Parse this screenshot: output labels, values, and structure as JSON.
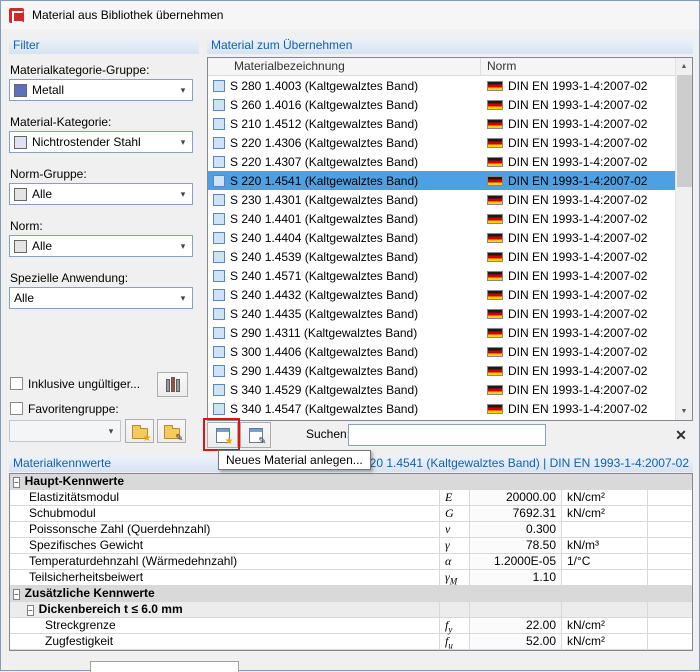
{
  "window": {
    "title": "Material aus Bibliothek übernehmen"
  },
  "colors": {
    "selection_bg": "#4da0e4",
    "band_text": "#1560a8",
    "annotation_red": "#e01212",
    "flag_black": "#1a1a1a",
    "flag_red": "#d00000",
    "flag_gold": "#ffce00"
  },
  "icons": {
    "combo_arrow": "▾",
    "scroll_up": "▲",
    "scroll_down": "▼",
    "clear": "✕",
    "new_star": "★",
    "pencil": "✎",
    "collapse": "−"
  },
  "filter": {
    "header": "Filter",
    "category_group": {
      "label": "Materialkategorie-Gruppe:",
      "value": "Metall",
      "icon_fill": "#5f6fc0"
    },
    "category": {
      "label": "Material-Kategorie:",
      "value": "Nichtrostender Stahl",
      "icon_fill": "#dfe2f2"
    },
    "norm_group": {
      "label": "Norm-Gruppe:",
      "value": "Alle",
      "icon_fill": "#e4e4e4"
    },
    "norm": {
      "label": "Norm:",
      "value": "Alle",
      "icon_fill": "#e4e4e4"
    },
    "special": {
      "label": "Spezielle Anwendung:",
      "value": "Alle"
    },
    "include_invalid_label": "Inklusive ungültiger...",
    "favorites_label": "Favoritengruppe:",
    "favorites_combo_value": ""
  },
  "materials": {
    "header": "Material zum Übernehmen",
    "columns": [
      "Materialbezeichnung",
      "Norm"
    ],
    "search_label": "Suchen:",
    "search_value": "",
    "tooltip": "Neues Material anlegen...",
    "selected_index": 5,
    "rows": [
      {
        "name": "S 280 1.4003 (Kaltgewalztes Band)",
        "norm": "DIN EN 1993-1-4:2007-02"
      },
      {
        "name": "S 260 1.4016 (Kaltgewalztes Band)",
        "norm": "DIN EN 1993-1-4:2007-02"
      },
      {
        "name": "S 210 1.4512 (Kaltgewalztes Band)",
        "norm": "DIN EN 1993-1-4:2007-02"
      },
      {
        "name": "S 220 1.4306 (Kaltgewalztes Band)",
        "norm": "DIN EN 1993-1-4:2007-02"
      },
      {
        "name": "S 220 1.4307 (Kaltgewalztes Band)",
        "norm": "DIN EN 1993-1-4:2007-02"
      },
      {
        "name": "S 220 1.4541 (Kaltgewalztes Band)",
        "norm": "DIN EN 1993-1-4:2007-02"
      },
      {
        "name": "S 230 1.4301 (Kaltgewalztes Band)",
        "norm": "DIN EN 1993-1-4:2007-02"
      },
      {
        "name": "S 240 1.4401 (Kaltgewalztes Band)",
        "norm": "DIN EN 1993-1-4:2007-02"
      },
      {
        "name": "S 240 1.4404 (Kaltgewalztes Band)",
        "norm": "DIN EN 1993-1-4:2007-02"
      },
      {
        "name": "S 240 1.4539 (Kaltgewalztes Band)",
        "norm": "DIN EN 1993-1-4:2007-02"
      },
      {
        "name": "S 240 1.4571 (Kaltgewalztes Band)",
        "norm": "DIN EN 1993-1-4:2007-02"
      },
      {
        "name": "S 240 1.4432 (Kaltgewalztes Band)",
        "norm": "DIN EN 1993-1-4:2007-02"
      },
      {
        "name": "S 240 1.4435 (Kaltgewalztes Band)",
        "norm": "DIN EN 1993-1-4:2007-02"
      },
      {
        "name": "S 290 1.4311 (Kaltgewalztes Band)",
        "norm": "DIN EN 1993-1-4:2007-02"
      },
      {
        "name": "S 300 1.4406 (Kaltgewalztes Band)",
        "norm": "DIN EN 1993-1-4:2007-02"
      },
      {
        "name": "S 290 1.4439 (Kaltgewalztes Band)",
        "norm": "DIN EN 1993-1-4:2007-02"
      },
      {
        "name": "S 340 1.4529 (Kaltgewalztes Band)",
        "norm": "DIN EN 1993-1-4:2007-02"
      },
      {
        "name": "S 340 1.4547 (Kaltgewalztes Band)",
        "norm": "DIN EN 1993-1-4:2007-02"
      }
    ]
  },
  "properties": {
    "header": "Materialkennwerte",
    "selection_info": "S 220 1.4541 (Kaltgewalztes Band) | DIN EN 1993-1-4:2007-02",
    "rows": [
      {
        "type": "group",
        "level": 0,
        "label": "Haupt-Kennwerte"
      },
      {
        "type": "data",
        "level": 1,
        "label": "Elastizitätsmodul",
        "symbol": "E",
        "sub": "",
        "value": "20000.00",
        "unit": "kN/cm²"
      },
      {
        "type": "data",
        "level": 1,
        "label": "Schubmodul",
        "symbol": "G",
        "sub": "",
        "value": "7692.31",
        "unit": "kN/cm²"
      },
      {
        "type": "data",
        "level": 1,
        "label": "Poissonsche Zahl (Querdehnzahl)",
        "symbol": "ν",
        "sub": "",
        "value": "0.300",
        "unit": ""
      },
      {
        "type": "data",
        "level": 1,
        "label": "Spezifisches Gewicht",
        "symbol": "γ",
        "sub": "",
        "value": "78.50",
        "unit": "kN/m³"
      },
      {
        "type": "data",
        "level": 1,
        "label": "Temperaturdehnzahl (Wärmedehnzahl)",
        "symbol": "α",
        "sub": "",
        "value": "1.2000E-05",
        "unit": "1/°C"
      },
      {
        "type": "data",
        "level": 1,
        "label": "Teilsicherheitsbeiwert",
        "symbol": "γ",
        "sub": "M",
        "value": "1.10",
        "unit": ""
      },
      {
        "type": "group",
        "level": 0,
        "label": "Zusätzliche Kennwerte"
      },
      {
        "type": "group",
        "level": 1,
        "label": "Dickenbereich t ≤ 6.0 mm"
      },
      {
        "type": "data",
        "level": 2,
        "label": "Streckgrenze",
        "symbol": "f",
        "sub": "y",
        "value": "22.00",
        "unit": "kN/cm²"
      },
      {
        "type": "data",
        "level": 2,
        "label": "Zugfestigkeit",
        "symbol": "f",
        "sub": "u",
        "value": "52.00",
        "unit": "kN/cm²"
      }
    ]
  }
}
